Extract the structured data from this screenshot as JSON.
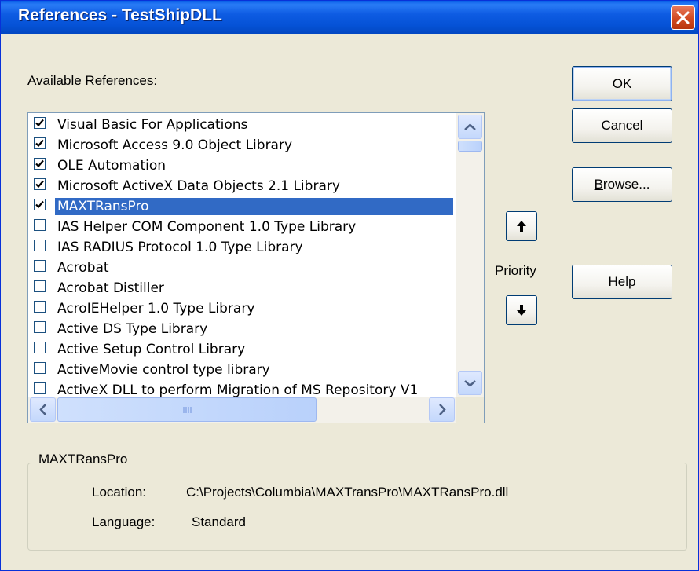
{
  "window": {
    "title": "References - TestShipDLL"
  },
  "available_label": "Available References:",
  "references": [
    {
      "name": "Visual Basic For Applications",
      "checked": true
    },
    {
      "name": "Microsoft Access 9.0 Object Library",
      "checked": true
    },
    {
      "name": "OLE Automation",
      "checked": true
    },
    {
      "name": "Microsoft ActiveX Data Objects 2.1 Library",
      "checked": true
    },
    {
      "name": "MAXTRansPro",
      "checked": true,
      "selected": true
    },
    {
      "name": " IAS Helper COM Component 1.0 Type Library",
      "checked": false
    },
    {
      "name": " IAS RADIUS Protocol 1.0 Type Library",
      "checked": false
    },
    {
      "name": "Acrobat",
      "checked": false
    },
    {
      "name": "Acrobat Distiller",
      "checked": false
    },
    {
      "name": "AcroIEHelper 1.0 Type Library",
      "checked": false
    },
    {
      "name": "Active DS Type Library",
      "checked": false
    },
    {
      "name": "Active Setup Control Library",
      "checked": false
    },
    {
      "name": "ActiveMovie control type library",
      "checked": false
    },
    {
      "name": "ActiveX DLL to perform Migration of MS Repository V1",
      "checked": false
    }
  ],
  "buttons": {
    "ok": "OK",
    "cancel": "Cancel",
    "browse": "Browse...",
    "help": "Help"
  },
  "priority_label": "Priority",
  "details": {
    "group_title": "MAXTRansPro",
    "location_label": "Location:",
    "location_value": "C:\\Projects\\Columbia\\MAXTransPro\\MAXTRansPro.dll",
    "language_label": "Language:",
    "language_value": "Standard"
  },
  "colors": {
    "title_bar": "#0a5fe8",
    "selection": "#316ac5",
    "face": "#ece9d8"
  }
}
